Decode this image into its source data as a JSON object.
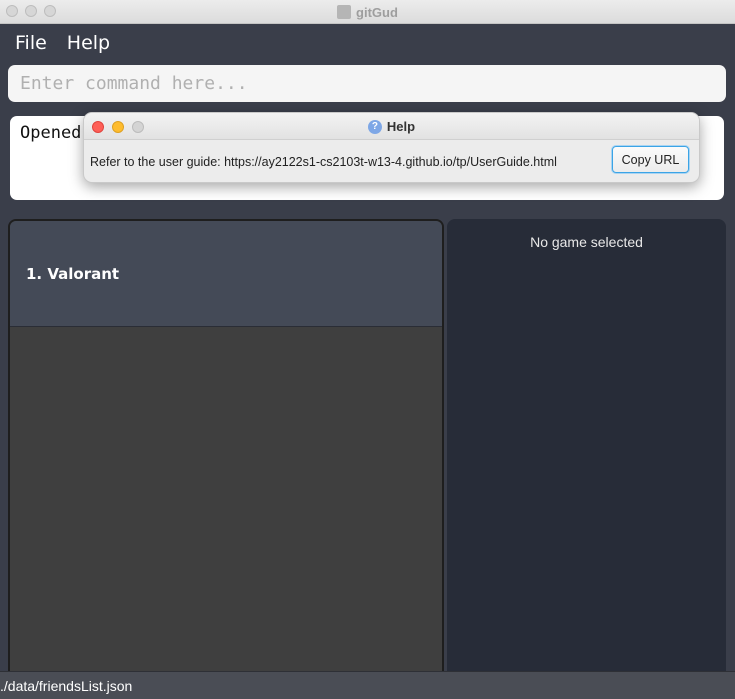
{
  "window": {
    "title": "gitGud"
  },
  "menu": {
    "items": [
      {
        "label": "File"
      },
      {
        "label": "Help"
      }
    ]
  },
  "command": {
    "placeholder": "Enter command here...",
    "value": ""
  },
  "result": {
    "text": "Opened"
  },
  "list": {
    "items": [
      {
        "label": "1.  Valorant"
      }
    ]
  },
  "detail": {
    "empty_text": "No game selected"
  },
  "status": {
    "path": "./data/friendsList.json"
  },
  "help_dialog": {
    "title": "Help",
    "message": "Refer to the user guide: https://ay2122s1-cs2103t-w13-4.github.io/tp/UserGuide.html",
    "copy_button_label": "Copy URL",
    "icon": "question-mark-icon"
  },
  "colors": {
    "app_background": "#3a3e4a",
    "list_cell": "#444a57",
    "detail_panel": "#272c38",
    "close": "#fe5f57",
    "minimize": "#febc2e",
    "button_focus": "#3ba4e6"
  }
}
